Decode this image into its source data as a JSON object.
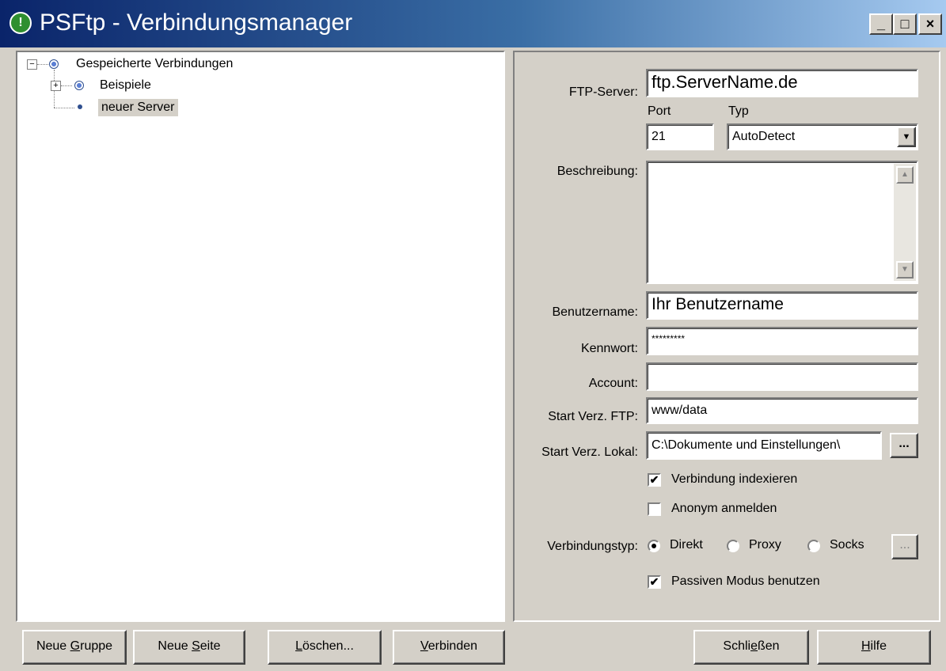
{
  "window": {
    "title": "PSFtp - Verbindungsmanager",
    "app_icon_glyph": "!",
    "controls": {
      "minimize": "_",
      "maximize": "□",
      "close": "×"
    }
  },
  "tree": {
    "root": {
      "label": "Gespeicherte Verbindungen",
      "expander": "−"
    },
    "children": [
      {
        "label": "Beispiele",
        "expander": "+"
      },
      {
        "label": "neuer Server",
        "selected": true
      }
    ]
  },
  "form": {
    "ftp_server": {
      "label": "FTP-Server:",
      "value": "ftp.ServerName.de"
    },
    "port": {
      "label": "Port",
      "value": "21"
    },
    "typ": {
      "label": "Typ",
      "value": "AutoDetect"
    },
    "beschreibung": {
      "label": "Beschreibung:",
      "value": ""
    },
    "benutzername": {
      "label": "Benutzername:",
      "value": "Ihr Benutzername"
    },
    "kennwort": {
      "label": "Kennwort:",
      "value": "*********"
    },
    "account": {
      "label": "Account:",
      "value": ""
    },
    "start_ftp": {
      "label": "Start Verz. FTP:",
      "value": "www/data"
    },
    "start_lokal": {
      "label": "Start Verz. Lokal:",
      "value": "C:\\Dokumente und Einstellungen\\",
      "browse_label": "..."
    },
    "verbindung_indexieren": {
      "label": "Verbindung indexieren",
      "checked": true
    },
    "anonym_anmelden": {
      "label": "Anonym anmelden",
      "checked": false
    },
    "verbindungstyp": {
      "label": "Verbindungstyp:",
      "options": [
        {
          "label": "Direkt",
          "selected": true
        },
        {
          "label": "Proxy",
          "selected": false
        },
        {
          "label": "Socks",
          "selected": false
        }
      ],
      "settings_label": "..."
    },
    "passiv": {
      "label": "Passiven Modus benutzen",
      "checked": true
    }
  },
  "buttons": {
    "neue_gruppe": {
      "pre": "Neue ",
      "u": "G",
      "post": "ruppe"
    },
    "neue_seite": {
      "pre": "Neue ",
      "u": "S",
      "post": "eite"
    },
    "loeschen": {
      "pre": "",
      "u": "L",
      "post": "öschen..."
    },
    "verbinden": {
      "pre": "",
      "u": "V",
      "post": "erbinden"
    },
    "schliessen": {
      "pre": "Schli",
      "u": "e",
      "post": "ßen"
    },
    "hilfe": {
      "pre": "",
      "u": "H",
      "post": "ilfe"
    }
  },
  "icons": {
    "check_glyph": "✔",
    "expand_glyph": "+",
    "collapse_glyph": "−",
    "scroll_up": "▲",
    "scroll_down": "▼",
    "dropdown": "▼"
  }
}
